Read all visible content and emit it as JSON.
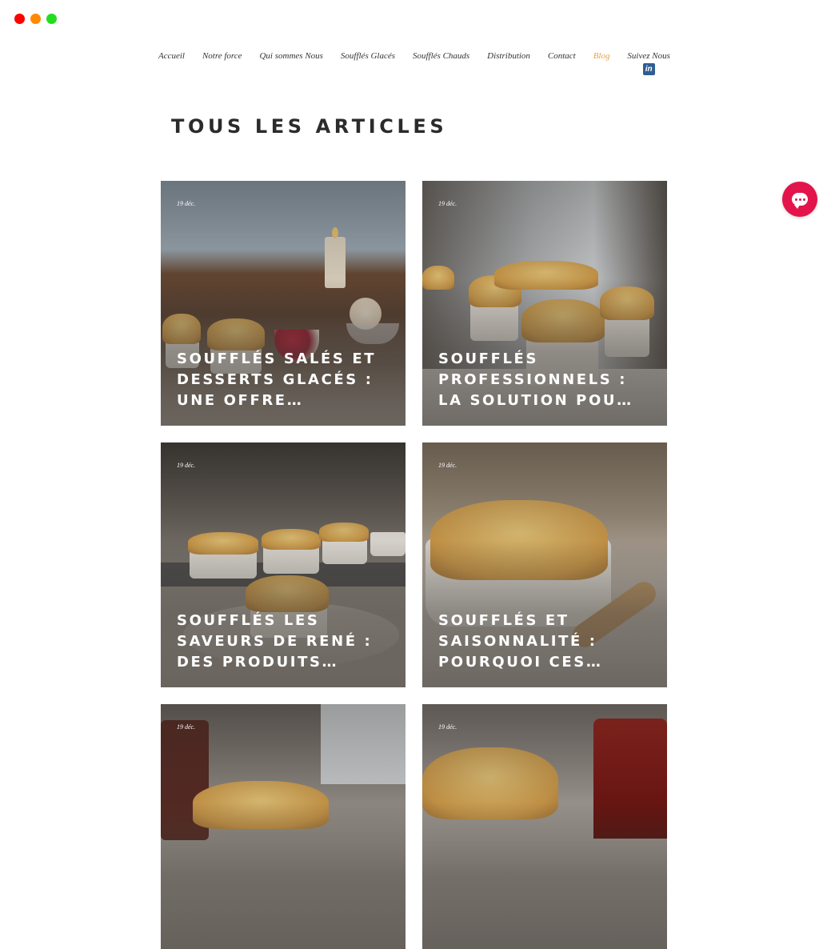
{
  "nav": {
    "items": [
      {
        "label": "Accueil"
      },
      {
        "label": "Notre force"
      },
      {
        "label": "Qui sommes Nous"
      },
      {
        "label": "Soufflés Glacés"
      },
      {
        "label": "Soufflés Chauds"
      },
      {
        "label": "Distribution"
      },
      {
        "label": "Contact"
      },
      {
        "label": "Blog",
        "active": true
      },
      {
        "label": "Suivez Nous"
      }
    ],
    "social_icon": "linkedin-icon"
  },
  "page_title": "TOUS LES ARTICLES",
  "posts": [
    {
      "date": "19 déc.",
      "title_lines": [
        "SOUFFLÉS SALÉS ET",
        "DESSERTS GLACÉS :",
        "UNE OFFRE…"
      ]
    },
    {
      "date": "19 déc.",
      "title_lines": [
        "SOUFFLÉS",
        "PROFESSIONNELS :",
        "LA SOLUTION POU…"
      ]
    },
    {
      "date": "19 déc.",
      "title_lines": [
        "SOUFFLÉS LES",
        "SAVEURS DE RENÉ :",
        "DES PRODUITS…"
      ]
    },
    {
      "date": "19 déc.",
      "title_lines": [
        "SOUFFLÉS ET",
        "SAISONNALITÉ :",
        "POURQUOI CES…"
      ]
    },
    {
      "date": "19 déc.",
      "title_lines": []
    },
    {
      "date": "19 déc.",
      "title_lines": []
    }
  ],
  "chat_icon": "chat-icon",
  "colors": {
    "accent": "#e8a04a",
    "chat": "#e3144b",
    "linkedin": "#2f5e92"
  }
}
